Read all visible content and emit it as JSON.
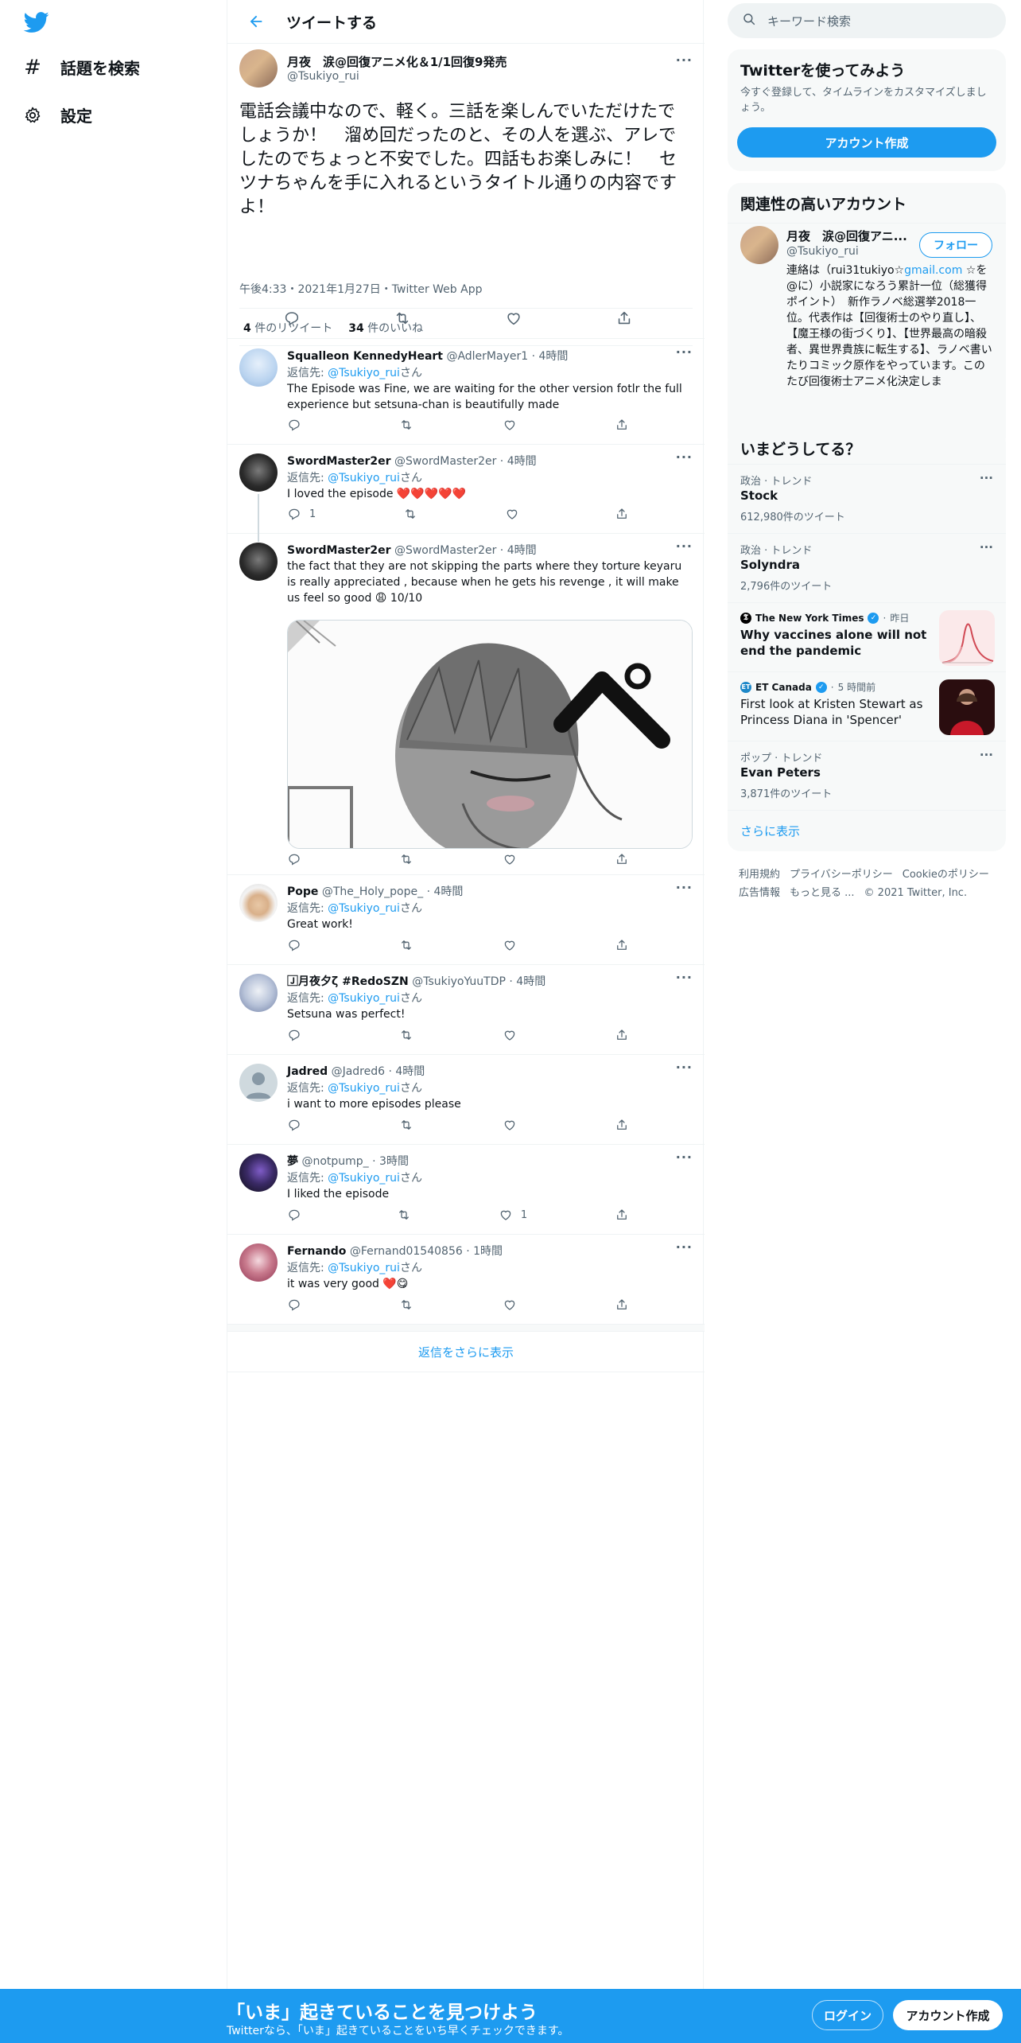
{
  "nav": {
    "items": [
      {
        "label": "話題を検索",
        "icon": "hashtag-icon"
      },
      {
        "label": "設定",
        "icon": "gear-icon"
      }
    ]
  },
  "header": {
    "title": "ツイートする"
  },
  "main_tweet": {
    "name": "月夜　涙@回復アニメ化＆1/1回復9発売",
    "handle": "@Tsukiyo_rui",
    "text": "電話会議中なので、軽く。三話を楽しんでいただけたでしょうか！　溜め回だったのと、その人を選ぶ、アレでしたのでちょっと不安でした。四話もお楽しみに！　セツナちゃんを手に入れるというタイトル通りの内容ですよ！",
    "meta": "午後4:33・2021年1月27日・Twitter Web App",
    "retweets": "4",
    "retweets_label": " 件のリツイート",
    "likes": "34",
    "likes_label": " 件のいいね"
  },
  "reply_to_label": "返信先: ",
  "reply_to_handle": "@Tsukiyo_rui",
  "reply_to_suffix": "さん",
  "replies": [
    {
      "name": "Squalleon KennedyHeart",
      "handle": "@AdlerMayer1",
      "time": "4時間",
      "text": "The Episode was Fine, we are waiting for the other version fotlr the full experience but setsuna-chan is beautifully made",
      "reply_count": "",
      "like_count": ""
    },
    {
      "name": "SwordMaster2er",
      "handle": "@SwordMaster2er",
      "time": "4時間",
      "text": "I loved the episode ❤️❤️❤️❤️❤️",
      "reply_count": "1",
      "like_count": ""
    },
    {
      "name": "SwordMaster2er",
      "handle": "@SwordMaster2er",
      "time": "4時間",
      "text": "the fact that they are not skipping the parts where they torture keyaru is really appreciated , because when he gets his revenge , it will make us feel so good 😩 10/10",
      "reply_count": "",
      "like_count": ""
    },
    {
      "name": "Pope",
      "handle": "@The_Holy_pope_",
      "time": "4時間",
      "text": "Great work!",
      "reply_count": "",
      "like_count": ""
    },
    {
      "name": "🄹月夜夕ζ #RedoSZN",
      "handle": "@TsukiyoYuuTDP",
      "time": "4時間",
      "text": "Setsuna was perfect!",
      "reply_count": "",
      "like_count": ""
    },
    {
      "name": "Jadred",
      "handle": "@Jadred6",
      "time": "4時間",
      "text": "i want to more episodes please",
      "reply_count": "",
      "like_count": ""
    },
    {
      "name": "夢",
      "handle": "@notpump_",
      "time": "3時間",
      "text": "I liked the episode",
      "reply_count": "",
      "like_count": "1"
    },
    {
      "name": "Fernando",
      "handle": "@Fernand01540856",
      "time": "1時間",
      "text": "it was very good ❤️😋",
      "reply_count": "",
      "like_count": ""
    }
  ],
  "show_more_replies": "返信をさらに表示",
  "search": {
    "placeholder": "キーワード検索"
  },
  "signup_card": {
    "title": "Twitterを使ってみよう",
    "subtitle": "今すぐ登録して、タイムラインをカスタマイズしましょう。",
    "button": "アカウント作成"
  },
  "related": {
    "title": "関連性の高いアカウント",
    "name": "月夜　涙@回復アニ...",
    "handle": "@Tsukiyo_rui",
    "follow": "フォロー",
    "bio_pre": "連絡は（rui31tukiyo☆",
    "bio_link": "gmail.com",
    "bio_post": " ☆を@に）小説家になろう累計一位（総獲得ポイント）　新作ラノベ総選挙2018一位。代表作は【回復術士のやり直し】、【魔王様の街づくり】、【世界最高の暗殺者、異世界貴族に転生する】、ラノベ書いたりコミック原作をやっています。このたび回復術士アニメ化決定しま"
  },
  "trends": {
    "title": "いまどうしてる？",
    "items": [
      {
        "category": "政治 · トレンド",
        "name": "Stock",
        "count": "612,980件のツイート"
      },
      {
        "category": "政治 · トレンド",
        "name": "Solyndra",
        "count": "2,796件のツイート"
      },
      {
        "source": "The New York Times",
        "time": "昨日",
        "headline": "Why vaccines alone will not end the pandemic"
      },
      {
        "source": "ET Canada",
        "time": "5 時間前",
        "headline": "First look at Kristen Stewart as Princess Diana in 'Spencer'"
      },
      {
        "category": "ポップ · トレンド",
        "name": "Evan Peters",
        "count": "3,871件のツイート"
      }
    ],
    "show_more": "さらに表示"
  },
  "footer": {
    "links": [
      "利用規約",
      "プライバシーポリシー",
      "Cookieのポリシー",
      "広告情報",
      "もっと見る ..."
    ],
    "copyright": "© 2021 Twitter, Inc."
  },
  "bottom_bar": {
    "title": "「いま」起きていることを見つけよう",
    "subtitle": "Twitterなら、「いま」起きていることをいち早くチェックできます。",
    "login": "ログイン",
    "signup": "アカウント作成"
  },
  "colors": {
    "accent": "#1d9bf0",
    "text": "#0f1419",
    "muted": "#536471",
    "border": "#eff3f4"
  }
}
